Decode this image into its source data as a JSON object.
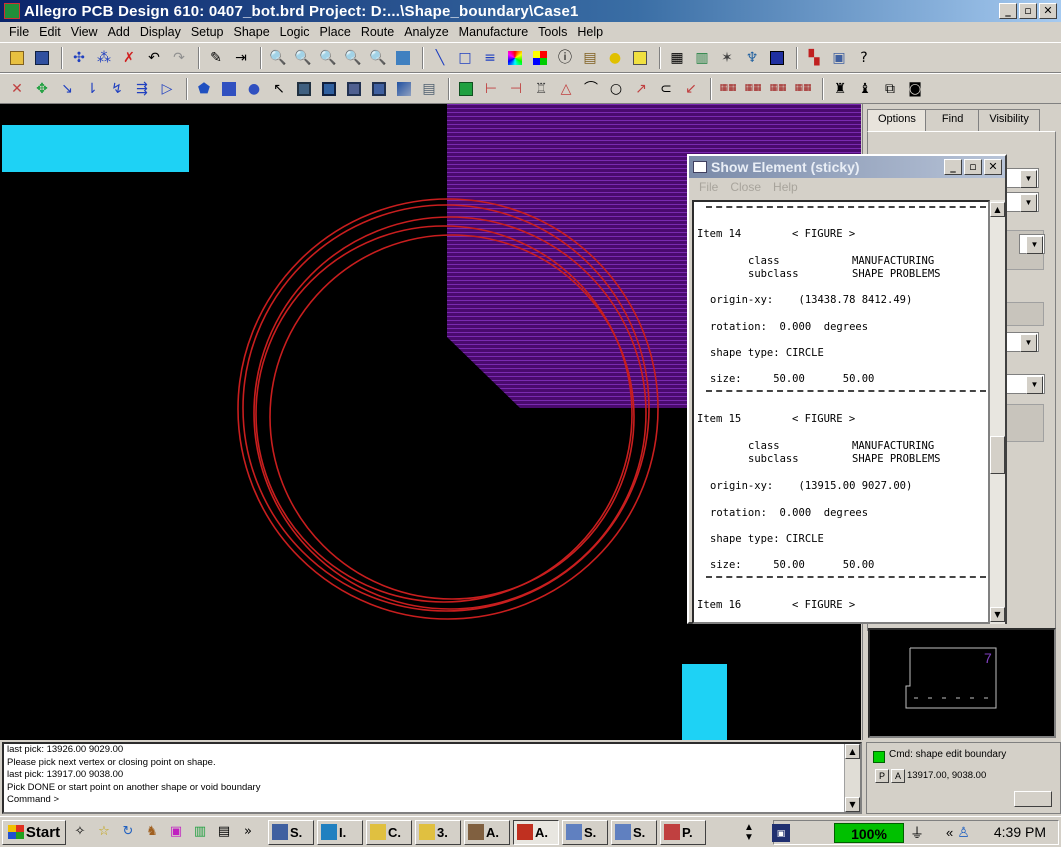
{
  "window": {
    "title": "Allegro PCB Design 610: 0407_bot.brd  Project: D:...\\Shape_boundary\\Case1",
    "minimize": "_",
    "maximize": "▫",
    "close": "✕"
  },
  "menu": [
    "File",
    "Edit",
    "View",
    "Add",
    "Display",
    "Setup",
    "Shape",
    "Logic",
    "Place",
    "Route",
    "Analyze",
    "Manufacture",
    "Tools",
    "Help"
  ],
  "panel": {
    "tabs": [
      "Options",
      "Find",
      "Visibility"
    ]
  },
  "show_element": {
    "title": "Show Element (sticky)",
    "menu": [
      "File",
      "Close",
      "Help"
    ],
    "items": [
      {
        "header": "Item 14",
        "type": "< FIGURE >",
        "class_label": "class",
        "class_value": "MANUFACTURING",
        "subclass_label": "subclass",
        "subclass_value": "SHAPE PROBLEMS",
        "origin": "origin-xy:    (13438.78 8412.49)",
        "rotation": "rotation:  0.000  degrees",
        "shape_type": "shape type: CIRCLE",
        "size": "size:     50.00      50.00"
      },
      {
        "header": "Item 15",
        "type": "< FIGURE >",
        "class_label": "class",
        "class_value": "MANUFACTURING",
        "subclass_label": "subclass",
        "subclass_value": "SHAPE PROBLEMS",
        "origin": "origin-xy:    (13915.00 9027.00)",
        "rotation": "rotation:  0.000  degrees",
        "shape_type": "shape type: CIRCLE",
        "size": "size:     50.00      50.00"
      }
    ],
    "next_item": {
      "header": "Item 16",
      "type": "< FIGURE >"
    }
  },
  "command": {
    "lines": [
      "last pick:  13926.00 9029.00",
      "Please pick next vertex or closing point on shape.",
      "last pick:  13917.00 9038.00",
      "Pick DONE or start point on another shape or void boundary",
      "Command >"
    ]
  },
  "status": {
    "cmd": "Cmd:  shape edit boundary",
    "p_button": "P",
    "a_button": "A",
    "xy": "13917.00, 9038.00"
  },
  "worldview": {
    "label": "7"
  },
  "taskbar": {
    "start": "Start",
    "overflow": "»",
    "tasks": [
      {
        "label": "S."
      },
      {
        "label": "I."
      },
      {
        "label": "C."
      },
      {
        "label": "3."
      },
      {
        "label": "A."
      },
      {
        "label": "A."
      },
      {
        "label": "S."
      },
      {
        "label": "S."
      },
      {
        "label": "P."
      }
    ],
    "battery": "100%",
    "tray_chevron": "«",
    "clock": "4:39 PM"
  },
  "colors": {
    "shape_fill": "#4a0a6e",
    "shape_lines": "#7a2ab0",
    "circle_stroke": "#c81e1e",
    "pad": "#1ed2f5",
    "canvas": "#000000"
  }
}
